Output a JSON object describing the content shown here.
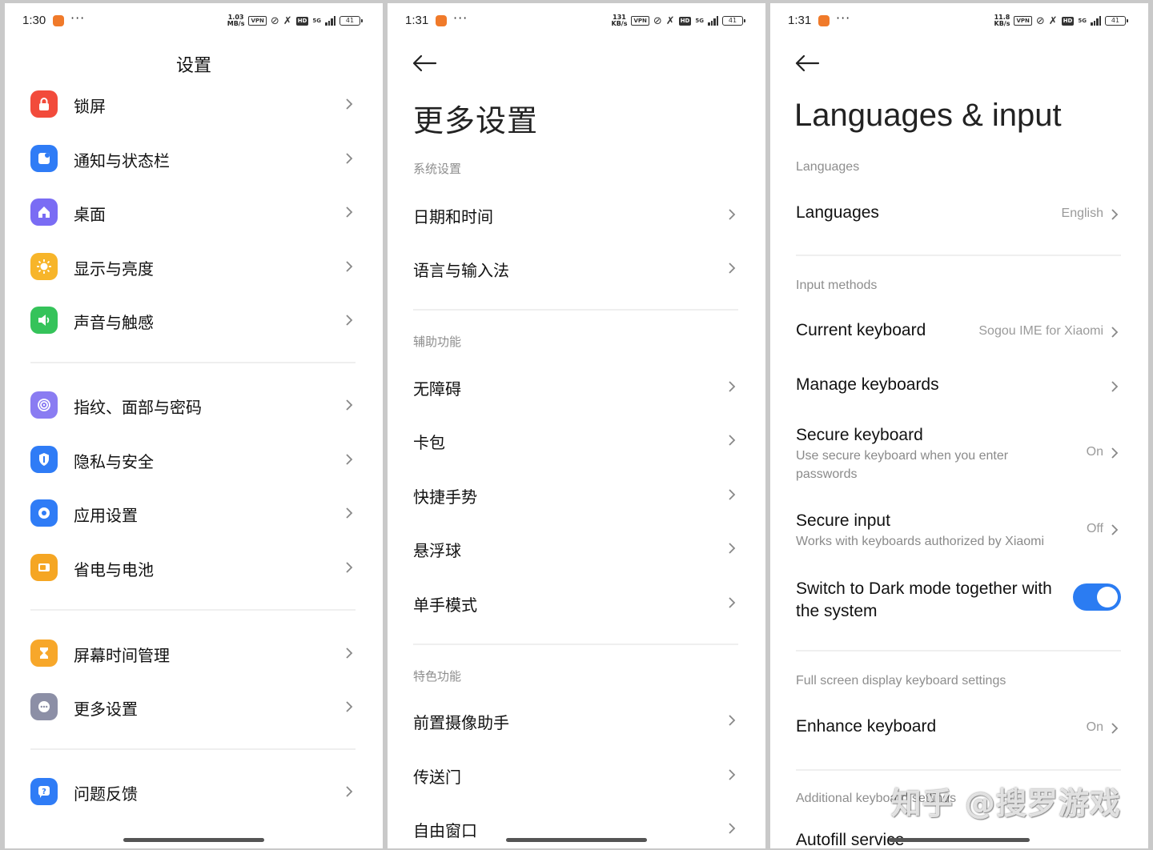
{
  "panel1": {
    "status": {
      "time": "1:30",
      "speed_value": "1.03",
      "speed_unit": "MB/s",
      "vpn": "VPN",
      "hd": "HD",
      "net": "5G",
      "battery": "41"
    },
    "title": "设置",
    "items": [
      {
        "label": "锁屏",
        "icon": "lock-icon",
        "color": "#f24b3b"
      },
      {
        "label": "通知与状态栏",
        "icon": "notification-icon",
        "color": "#2f7cf6"
      },
      {
        "label": "桌面",
        "icon": "home-icon",
        "color": "#7a6cf4"
      },
      {
        "label": "显示与亮度",
        "icon": "sun-icon",
        "color": "#f7b52a"
      },
      {
        "label": "声音与触感",
        "icon": "speaker-icon",
        "color": "#35c35a"
      },
      {
        "label": "指纹、面部与密码",
        "icon": "fingerprint-icon",
        "color": "#8a7cf2"
      },
      {
        "label": "隐私与安全",
        "icon": "shield-icon",
        "color": "#2f7cf6"
      },
      {
        "label": "应用设置",
        "icon": "app-settings-icon",
        "color": "#2f7cf6"
      },
      {
        "label": "省电与电池",
        "icon": "battery-icon",
        "color": "#f5a623"
      },
      {
        "label": "屏幕时间管理",
        "icon": "hourglass-icon",
        "color": "#f7a72a"
      },
      {
        "label": "更多设置",
        "icon": "more-icon",
        "color": "#8c8fa6"
      },
      {
        "label": "问题反馈",
        "icon": "feedback-icon",
        "color": "#2f7cf6"
      }
    ]
  },
  "panel2": {
    "status": {
      "time": "1:31",
      "speed_value": "131",
      "speed_unit": "KB/s",
      "vpn": "VPN",
      "hd": "HD",
      "net": "5G",
      "battery": "41"
    },
    "title": "更多设置",
    "section_system": "系统设置",
    "system_items": [
      "日期和时间",
      "语言与输入法"
    ],
    "section_access": "辅助功能",
    "access_items": [
      "无障碍",
      "卡包",
      "快捷手势",
      "悬浮球",
      "单手模式"
    ],
    "section_features": "特色功能",
    "feature_items": [
      "前置摄像助手",
      "传送门",
      "自由窗口"
    ]
  },
  "panel3": {
    "status": {
      "time": "1:31",
      "speed_value": "11.8",
      "speed_unit": "KB/s",
      "vpn": "VPN",
      "hd": "HD",
      "net": "5G",
      "battery": "41"
    },
    "title": "Languages & input",
    "section_languages": "Languages",
    "languages_label": "Languages",
    "languages_value": "English",
    "section_input": "Input methods",
    "current_keyboard_label": "Current keyboard",
    "current_keyboard_value": "Sogou IME for Xiaomi",
    "manage_keyboards_label": "Manage keyboards",
    "secure_keyboard_label": "Secure keyboard",
    "secure_keyboard_sub": "Use secure keyboard when you enter passwords",
    "secure_keyboard_value": "On",
    "secure_input_label": "Secure input",
    "secure_input_sub": "Works with keyboards authorized by Xiaomi",
    "secure_input_value": "Off",
    "dark_mode_label": "Switch to Dark mode together with the system",
    "dark_mode_on": true,
    "section_fullscreen": "Full screen display keyboard settings",
    "enhance_label": "Enhance keyboard",
    "enhance_value": "On",
    "section_additional": "Additional keyboard settings",
    "autofill_label": "Autofill service"
  },
  "watermark": "知乎 @搜罗游戏",
  "accent": "#2b7cf2"
}
